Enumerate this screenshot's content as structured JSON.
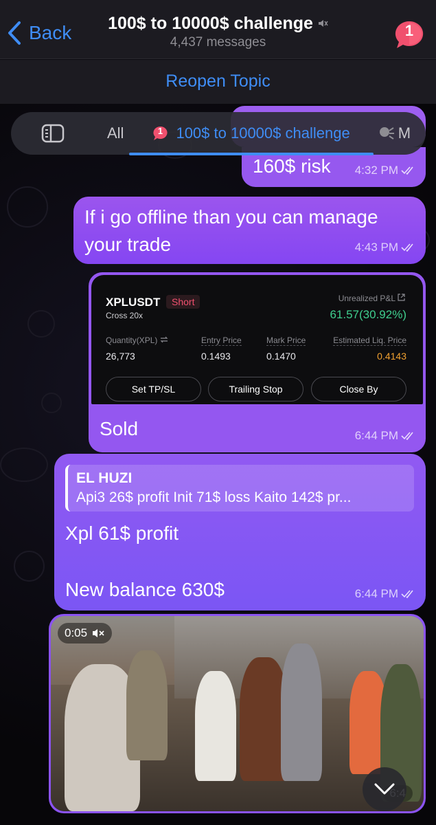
{
  "header": {
    "back_label": "Back",
    "title": "100$ to 10000$ challenge",
    "subtitle": "4,437 messages",
    "unread_badge": "1",
    "muted": true
  },
  "reopen": {
    "label": "Reopen Topic"
  },
  "tabs": {
    "all_label": "All",
    "active_label": "100$ to 10000$ challenge",
    "active_badge": "1",
    "next_label": "M"
  },
  "messages": [
    {
      "id": "risk",
      "text": "160$ risk",
      "time": "4:32 PM"
    },
    {
      "id": "offline",
      "text": "If i go offline than you can manage your trade",
      "time": "4:43 PM"
    },
    {
      "id": "sold",
      "text": "Sold",
      "time": "6:44 PM",
      "trade_card": {
        "symbol": "XPLUSDT",
        "side": "Short",
        "margin": "Cross 20x",
        "pnl_label": "Unrealized P&L",
        "pnl_value": "61.57(30.92%)",
        "qty_label": "Quantity(XPL)",
        "qty_value": "26,773",
        "entry_label": "Entry Price",
        "entry_value": "0.1493",
        "mark_label": "Mark Price",
        "mark_value": "0.1470",
        "liq_label": "Estimated Liq. Price",
        "liq_value": "0.4143",
        "btn_tpsl": "Set TP/SL",
        "btn_trailing": "Trailing Stop",
        "btn_close": "Close By"
      }
    },
    {
      "id": "balance",
      "reply_name": "EL HUZI",
      "reply_snippet": "Api3 26$ profit Init 71$ loss Kaito 142$ pr...",
      "line1": "Xpl 61$ profit",
      "line2": "New balance 630$",
      "time": "6:44 PM"
    },
    {
      "id": "video",
      "duration": "0:05",
      "time": "6:4"
    }
  ],
  "colors": {
    "accent": "#3f8df5",
    "bubble": "#8b4ff1",
    "pnl_green": "#3fce8e",
    "short_red": "#f0506e",
    "liq_orange": "#f0a030"
  }
}
